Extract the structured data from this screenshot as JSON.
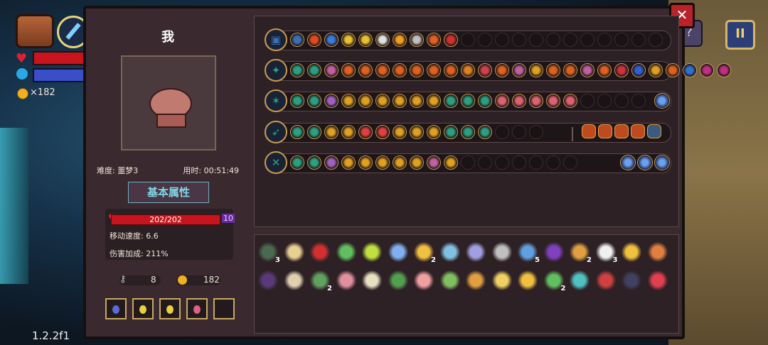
{
  "hud": {
    "coins": "×182",
    "version": "1.2.2f1",
    "pause_label": "II",
    "help_label": "?"
  },
  "panel": {
    "close_label": "✕",
    "character": {
      "name": "我",
      "difficulty": "难度: 噩梦3",
      "time": "用时: 00:51:49",
      "attr_button": "基本属性",
      "hp": "202/202",
      "shield": "10",
      "move_speed": "移动速度: 6.6",
      "damage_bonus": "伤害加成: 211%",
      "keys": "8",
      "coins": "182"
    },
    "potions": [
      {
        "name": "blue-potion",
        "color": "#5a6ad8"
      },
      {
        "name": "yellow-potion",
        "color": "#e8d040"
      },
      {
        "name": "yellow-potion",
        "color": "#e8d040"
      },
      {
        "name": "pink-potion",
        "color": "#e06080"
      },
      {
        "name": "empty-slot",
        "color": "#221a1c"
      }
    ]
  },
  "weapon_rows": [
    {
      "name": "chest-row",
      "filled": 10,
      "empty": 12,
      "colors": [
        "#3a6fb0",
        "#e04a20",
        "#3a7ad8",
        "#e8c030",
        "#e8c030",
        "#e0e0e0",
        "#f0a020",
        "#c0c0c0",
        "#e06020",
        "#d03030"
      ]
    },
    {
      "name": "ice-sword-row",
      "filled": 26,
      "empty": 0,
      "colors": [
        "#2aa080",
        "#2aa080",
        "#c060a0",
        "#e06020",
        "#e06020",
        "#e06020",
        "#e06020",
        "#e06020",
        "#e06020",
        "#e06020",
        "#e08020",
        "#d04050",
        "#e06020",
        "#c060a0",
        "#e0a020",
        "#e06020",
        "#e06020",
        "#c060a0",
        "#e06020",
        "#d03040",
        "#3060d0",
        "#e0a020",
        "#e06020",
        "#3070d0",
        "#c03080",
        "#c03080"
      ]
    },
    {
      "name": "staff-row",
      "filled": 17,
      "empty": 4,
      "tail": 1,
      "colors": [
        "#2aa080",
        "#2aa080",
        "#a060c0",
        "#e0a020",
        "#e0a020",
        "#e0a020",
        "#e0a020",
        "#e0a020",
        "#e0a020",
        "#2aa080",
        "#2aa080",
        "#2aa080",
        "#e06070",
        "#e06070",
        "#e06070",
        "#e06070",
        "#e06070"
      ]
    },
    {
      "name": "bow-row",
      "filled": 12,
      "empty": 3,
      "extra": 5,
      "colors": [
        "#2aa080",
        "#2aa080",
        "#e0a020",
        "#e0a020",
        "#e04040",
        "#e04040",
        "#e0a020",
        "#e0a020",
        "#e0a020",
        "#2aa080",
        "#2aa080",
        "#2aa080"
      ]
    },
    {
      "name": "shuriken-row",
      "filled": 10,
      "empty": 7,
      "tail": 3,
      "colors": [
        "#2aa080",
        "#2aa080",
        "#a060c0",
        "#e0a020",
        "#e0a020",
        "#e0a020",
        "#e0a020",
        "#e0a020",
        "#c060a0",
        "#e0a020"
      ]
    }
  ],
  "items": {
    "row1": [
      {
        "name": "cloak-item",
        "color": "#4a6a50",
        "count": "3"
      },
      {
        "name": "bread-item",
        "color": "#e8d090",
        "count": ""
      },
      {
        "name": "devil-mask-item",
        "color": "#d03030",
        "count": ""
      },
      {
        "name": "leaf-item",
        "color": "#60c060",
        "count": ""
      },
      {
        "name": "battery-item",
        "color": "#c0e040",
        "count": ""
      },
      {
        "name": "mirror-item",
        "color": "#80b0f0",
        "count": ""
      },
      {
        "name": "gem-item",
        "color": "#f0c040",
        "count": "2"
      },
      {
        "name": "compass-item",
        "color": "#80c0e0",
        "count": ""
      },
      {
        "name": "hand-item",
        "color": "#a0a0e0",
        "count": ""
      },
      {
        "name": "rod-item",
        "color": "#c0c0c0",
        "count": ""
      },
      {
        "name": "bird-item",
        "color": "#60a0e0",
        "count": "5"
      },
      {
        "name": "wizard-hat-item",
        "color": "#8040c0",
        "count": ""
      },
      {
        "name": "pickaxe-item",
        "color": "#e0a040",
        "count": "2"
      },
      {
        "name": "feather-item",
        "color": "#f0f0f0",
        "count": "3"
      },
      {
        "name": "goblet-item",
        "color": "#f0c040",
        "count": ""
      },
      {
        "name": "arrow-item",
        "color": "#e08040",
        "count": ""
      }
    ],
    "row2": [
      {
        "name": "dark-cloak-item",
        "color": "#5a3a7a",
        "count": ""
      },
      {
        "name": "skull-item",
        "color": "#e0d0b0",
        "count": ""
      },
      {
        "name": "hammer-item",
        "color": "#60a060",
        "count": "2"
      },
      {
        "name": "brain-item",
        "color": "#e090a0",
        "count": ""
      },
      {
        "name": "bone-item",
        "color": "#e8e0c0",
        "count": ""
      },
      {
        "name": "frog-item",
        "color": "#50a050",
        "count": ""
      },
      {
        "name": "pig-item",
        "color": "#f0a0a0",
        "count": ""
      },
      {
        "name": "sprout-item",
        "color": "#80c060",
        "count": ""
      },
      {
        "name": "gauntlet-item",
        "color": "#e0a040",
        "count": ""
      },
      {
        "name": "cheese-item",
        "color": "#f0d060",
        "count": ""
      },
      {
        "name": "bell-item",
        "color": "#f0c040",
        "count": ""
      },
      {
        "name": "snake-item",
        "color": "#60c060",
        "count": "2"
      },
      {
        "name": "syringe-item",
        "color": "#50c0c0",
        "count": ""
      },
      {
        "name": "rune-item",
        "color": "#d04040",
        "count": ""
      },
      {
        "name": "helmet-item",
        "color": "#404060",
        "count": ""
      },
      {
        "name": "flower-item",
        "color": "#e04050",
        "count": ""
      }
    ]
  }
}
